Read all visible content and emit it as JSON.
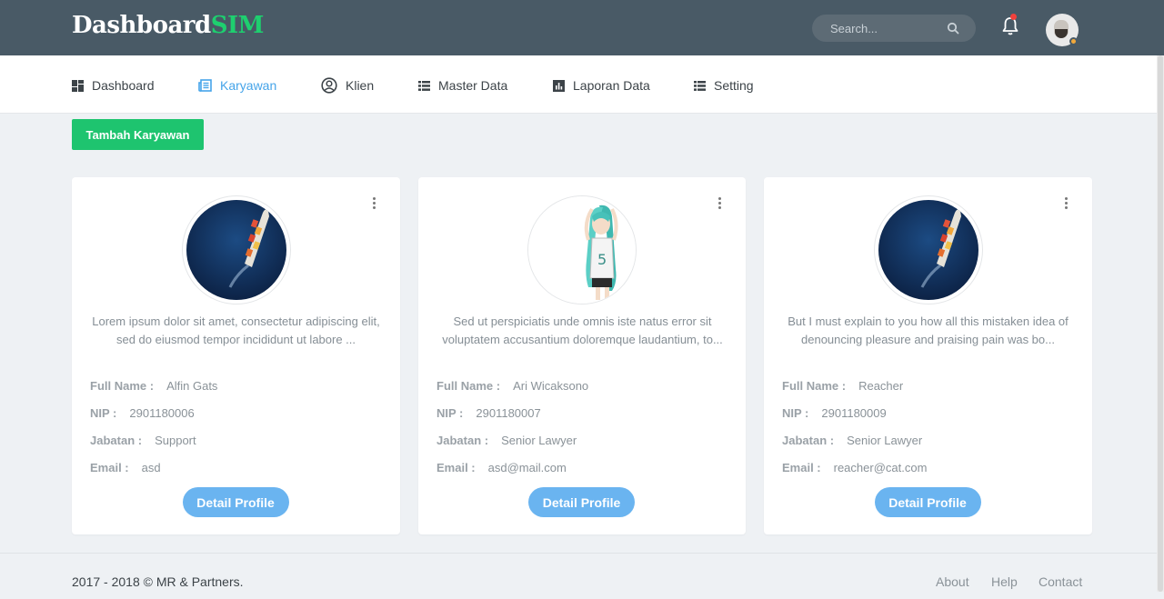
{
  "header": {
    "logo_part1": "Dashboard",
    "logo_part2": "SIM",
    "search_placeholder": "Search...",
    "brand_color": "#1ecf6f",
    "topbar_color": "#495a66"
  },
  "nav": {
    "items": [
      {
        "label": "Dashboard",
        "icon": "dashboard-icon"
      },
      {
        "label": "Karyawan",
        "icon": "newspaper-icon",
        "active": true
      },
      {
        "label": "Klien",
        "icon": "user-circle-icon"
      },
      {
        "label": "Master Data",
        "icon": "list-icon"
      },
      {
        "label": "Laporan Data",
        "icon": "bar-chart-icon"
      },
      {
        "label": "Setting",
        "icon": "list-icon"
      }
    ]
  },
  "actions": {
    "add_label": "Tambah Karyawan"
  },
  "labels": {
    "full_name": "Full Name :",
    "nip": "NIP :",
    "jabatan": "Jabatan :",
    "email": "Email :",
    "detail": "Detail Profile"
  },
  "cards": [
    {
      "desc_line1": "Lorem ipsum dolor sit amet, consectetur adipiscing elit,",
      "desc_line2": "sed do eiusmod tempor incididunt ut labore ...",
      "full_name": "Alfin Gats",
      "nip": "2901180006",
      "jabatan": "Support",
      "email": "asd",
      "photo": "ship-photo"
    },
    {
      "desc_line1": "Sed ut perspiciatis unde omnis iste natus error sit",
      "desc_line2": "voluptatem accusantium doloremque laudantium, to...",
      "full_name": "Ari Wicaksono",
      "nip": "2901180007",
      "jabatan": "Senior Lawyer",
      "email": "asd@mail.com",
      "photo": "anime-character-photo"
    },
    {
      "desc_line1": "But I must explain to you how all this mistaken idea of",
      "desc_line2": "denouncing pleasure and praising pain was bo...",
      "full_name": "Reacher",
      "nip": "2901180009",
      "jabatan": "Senior Lawyer",
      "email": "reacher@cat.com",
      "photo": "ship-photo"
    }
  ],
  "footer": {
    "copyright": "2017 - 2018 © MR & Partners.",
    "links": [
      "About",
      "Help",
      "Contact"
    ]
  }
}
